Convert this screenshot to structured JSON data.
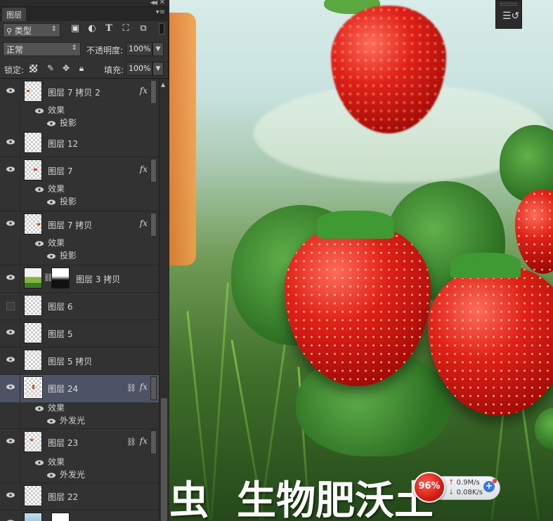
{
  "panel": {
    "tab_label": "图层",
    "filter": {
      "kind_label": "类型"
    },
    "blend": {
      "mode": "正常",
      "opacity_label": "不透明度:",
      "opacity_value": "100%"
    },
    "lock": {
      "label": "锁定:",
      "fill_label": "填充:",
      "fill_value": "100%"
    }
  },
  "layers": [
    {
      "name": "图层 7 拷贝 2",
      "visible": true,
      "fx": true,
      "effects": [
        "效果",
        "投影"
      ]
    },
    {
      "name": "图层 12",
      "visible": true
    },
    {
      "name": "图层 7",
      "visible": true,
      "fx": true,
      "effects": [
        "效果",
        "投影"
      ]
    },
    {
      "name": "图层 7 拷贝",
      "visible": true,
      "fx": true,
      "effects": [
        "效果",
        "投影"
      ]
    },
    {
      "name": "图层 3 拷贝",
      "visible": true,
      "mask": true
    },
    {
      "name": "图层 6",
      "visible": false
    },
    {
      "name": "图层 5",
      "visible": true
    },
    {
      "name": "图层 5 拷贝",
      "visible": true
    },
    {
      "name": "图层 24",
      "visible": true,
      "fx": true,
      "linked": true,
      "selected": true,
      "effects": [
        "效果",
        "外发光"
      ]
    },
    {
      "name": "图层 23",
      "visible": true,
      "fx": true,
      "linked": true,
      "effects": [
        "效果",
        "外发光"
      ]
    },
    {
      "name": "图层 22",
      "visible": true
    }
  ],
  "fx_symbol": "fx",
  "canvas": {
    "headline_left": "虫",
    "headline_right": "生物肥沃土"
  },
  "net_widget": {
    "percent": "96%",
    "upload": "0.9M/s",
    "download": "0.08K/s"
  }
}
